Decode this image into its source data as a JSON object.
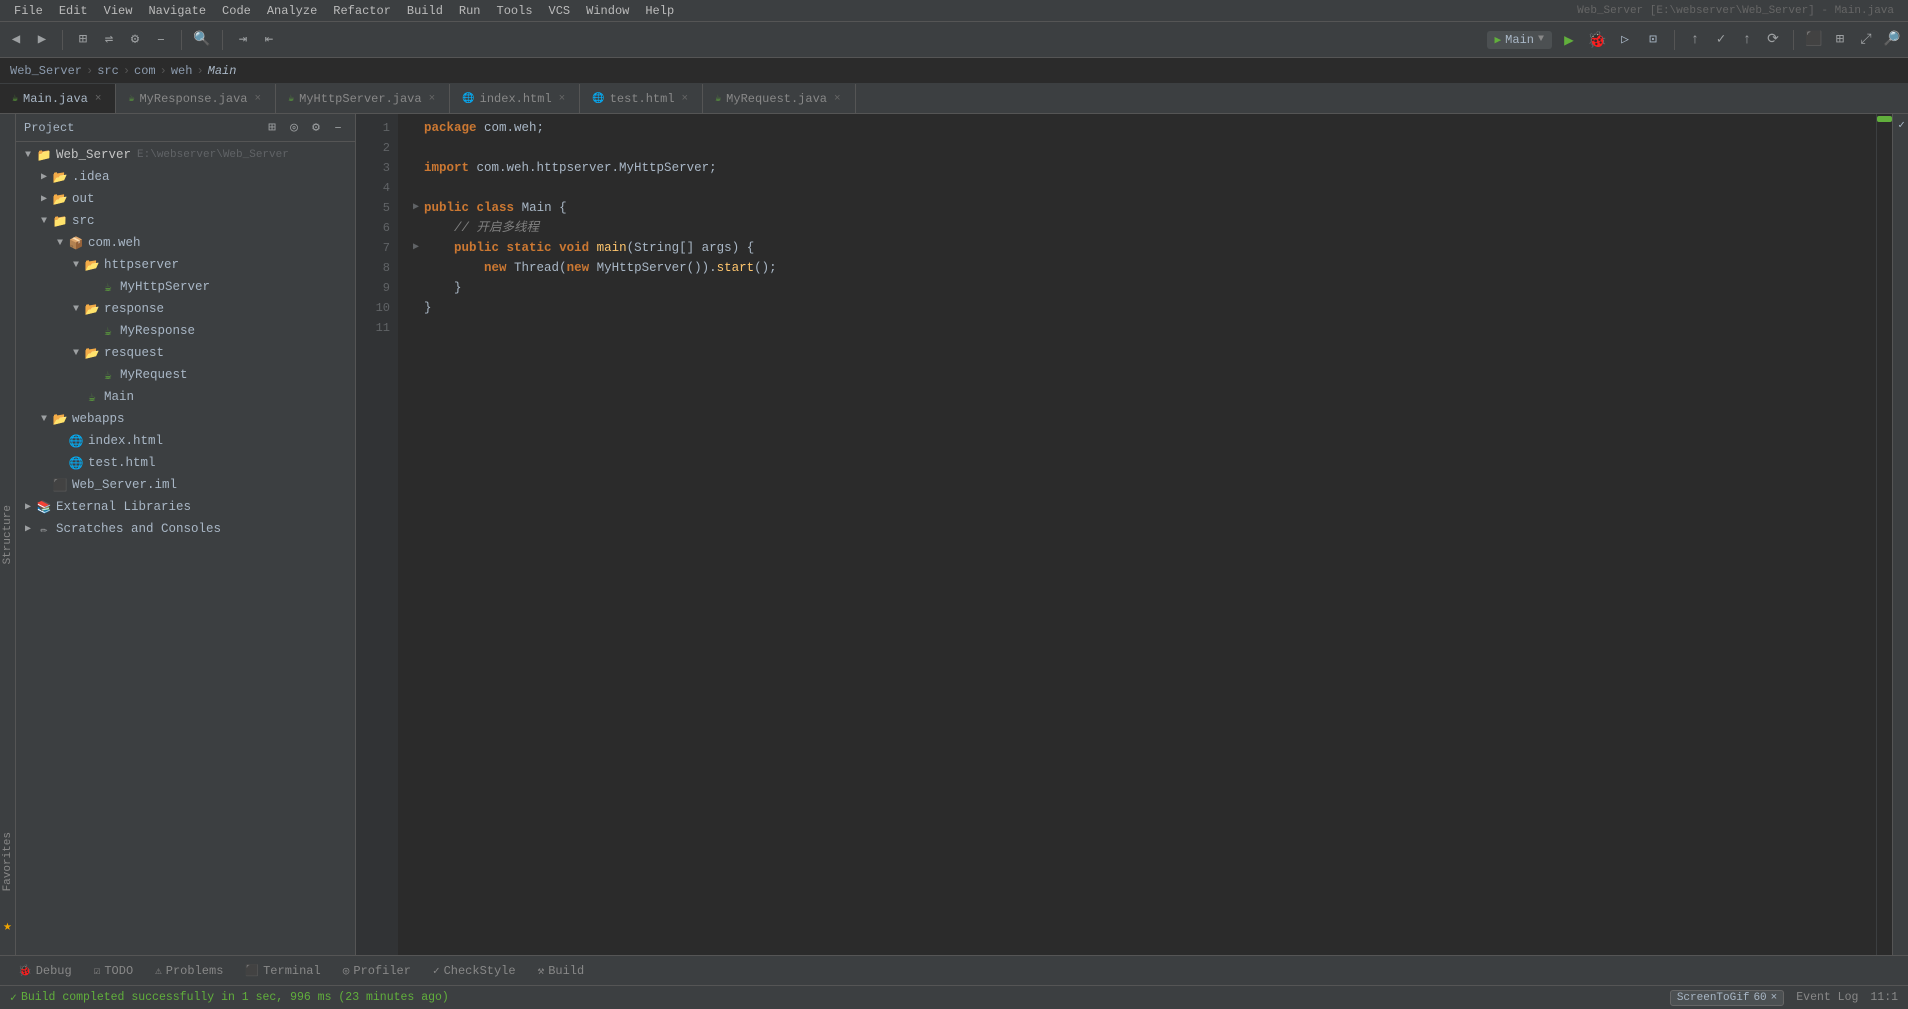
{
  "menubar": {
    "items": [
      "File",
      "Edit",
      "View",
      "Navigate",
      "Code",
      "Analyze",
      "Refactor",
      "Build",
      "Run",
      "Tools",
      "VCS",
      "Window",
      "Help"
    ],
    "title_prefix": "Web_Server",
    "title_path": "[E:\\webserver\\Web_Server] - Main.java"
  },
  "toolbar": {
    "run_config": "Main",
    "icons": {
      "back": "◀",
      "forward": "▶",
      "settings": "⚙",
      "minus": "–",
      "balance": "⇌",
      "indent": "⇥",
      "outdent": "⇤",
      "run": "▶",
      "debug": "🐛",
      "coverage": "▷",
      "profile": "⊞"
    }
  },
  "breadcrumb": {
    "items": [
      "Web_Server",
      "src",
      "com",
      "weh",
      "Main"
    ]
  },
  "tabs": [
    {
      "name": "Main.java",
      "type": "java",
      "active": true
    },
    {
      "name": "MyResponse.java",
      "type": "java",
      "active": false
    },
    {
      "name": "MyHttpServer.java",
      "type": "java",
      "active": false
    },
    {
      "name": "index.html",
      "type": "html",
      "active": false
    },
    {
      "name": "test.html",
      "type": "html",
      "active": false
    },
    {
      "name": "MyRequest.java",
      "type": "java",
      "active": false
    }
  ],
  "project": {
    "panel_title": "Project",
    "root": {
      "label": "Web_Server",
      "path": "E:\\webserver\\Web_Server",
      "children": [
        {
          "label": ".idea",
          "type": "folder",
          "expanded": false
        },
        {
          "label": "out",
          "type": "folder",
          "expanded": false
        },
        {
          "label": "src",
          "type": "src",
          "expanded": true,
          "children": [
            {
              "label": "com.weh",
              "type": "package",
              "expanded": true,
              "children": [
                {
                  "label": "httpserver",
                  "type": "folder",
                  "expanded": true,
                  "children": [
                    {
                      "label": "MyHttpServer",
                      "type": "java-class"
                    }
                  ]
                },
                {
                  "label": "response",
                  "type": "folder",
                  "expanded": true,
                  "children": [
                    {
                      "label": "MyResponse",
                      "type": "java-class"
                    }
                  ]
                },
                {
                  "label": "resquest",
                  "type": "folder",
                  "expanded": true,
                  "children": [
                    {
                      "label": "MyRequest",
                      "type": "java-class"
                    }
                  ]
                },
                {
                  "label": "Main",
                  "type": "java-main"
                }
              ]
            }
          ]
        },
        {
          "label": "webapps",
          "type": "folder",
          "expanded": true,
          "children": [
            {
              "label": "index.html",
              "type": "html"
            },
            {
              "label": "test.html",
              "type": "html"
            }
          ]
        },
        {
          "label": "Web_Server.iml",
          "type": "iml"
        }
      ]
    },
    "external_libraries": {
      "label": "External Libraries",
      "expanded": false
    },
    "scratches": {
      "label": "Scratches and Consoles",
      "expanded": false
    }
  },
  "editor": {
    "filename": "Main.java",
    "lines": [
      {
        "num": 1,
        "tokens": [
          {
            "t": "pkg",
            "v": "package com.weh;"
          }
        ]
      },
      {
        "num": 2,
        "tokens": []
      },
      {
        "num": 3,
        "tokens": [
          {
            "t": "kw",
            "v": "import"
          },
          {
            "t": "plain",
            "v": " com.weh.httpserver.MyHttpServer;"
          }
        ]
      },
      {
        "num": 4,
        "tokens": []
      },
      {
        "num": 5,
        "tokens": [
          {
            "t": "kw",
            "v": "public"
          },
          {
            "t": "plain",
            "v": " "
          },
          {
            "t": "kw",
            "v": "class"
          },
          {
            "t": "plain",
            "v": " "
          },
          {
            "t": "cls",
            "v": "Main"
          },
          {
            "t": "plain",
            "v": " {"
          }
        ]
      },
      {
        "num": 6,
        "tokens": [
          {
            "t": "cmt",
            "v": "//    开启多线程"
          }
        ]
      },
      {
        "num": 7,
        "tokens": [
          {
            "t": "kw",
            "v": "    public"
          },
          {
            "t": "plain",
            "v": " "
          },
          {
            "t": "kw",
            "v": "static"
          },
          {
            "t": "plain",
            "v": " "
          },
          {
            "t": "kw",
            "v": "void"
          },
          {
            "t": "plain",
            "v": " "
          },
          {
            "t": "fn",
            "v": "main"
          },
          {
            "t": "plain",
            "v": "("
          },
          {
            "t": "type",
            "v": "String"
          },
          {
            "t": "plain",
            "v": "[] "
          },
          {
            "t": "var",
            "v": "args"
          },
          {
            "t": "plain",
            "v": ") {"
          }
        ]
      },
      {
        "num": 8,
        "tokens": [
          {
            "t": "kw",
            "v": "        new"
          },
          {
            "t": "plain",
            "v": " "
          },
          {
            "t": "cls",
            "v": "Thread"
          },
          {
            "t": "plain",
            "v": "("
          },
          {
            "t": "kw",
            "v": "new"
          },
          {
            "t": "plain",
            "v": " "
          },
          {
            "t": "cls",
            "v": "MyHttpServer"
          },
          {
            "t": "plain",
            "v": "())."
          },
          {
            "t": "fn",
            "v": "start"
          },
          {
            "t": "plain",
            "v": "();"
          }
        ]
      },
      {
        "num": 9,
        "tokens": [
          {
            "t": "plain",
            "v": "    }"
          }
        ]
      },
      {
        "num": 10,
        "tokens": [
          {
            "t": "plain",
            "v": "}"
          }
        ]
      },
      {
        "num": 11,
        "tokens": []
      }
    ]
  },
  "bottom_tabs": [
    {
      "label": "Debug",
      "icon": "🐛"
    },
    {
      "label": "TODO",
      "icon": "☑"
    },
    {
      "label": "Problems",
      "icon": "⚠"
    },
    {
      "label": "Terminal",
      "icon": ">"
    },
    {
      "label": "Profiler",
      "icon": "◎"
    },
    {
      "label": "CheckStyle",
      "icon": "✓"
    },
    {
      "label": "Build",
      "icon": "⚒"
    }
  ],
  "statusbar": {
    "message": "Build completed successfully in 1 sec, 996 ms (23 minutes ago)",
    "position": "11:1",
    "screentogif": "ScreenToGif",
    "screentogif_num": "60"
  },
  "vert_tabs": {
    "structure": "Structure",
    "favorites": "Favorites"
  }
}
